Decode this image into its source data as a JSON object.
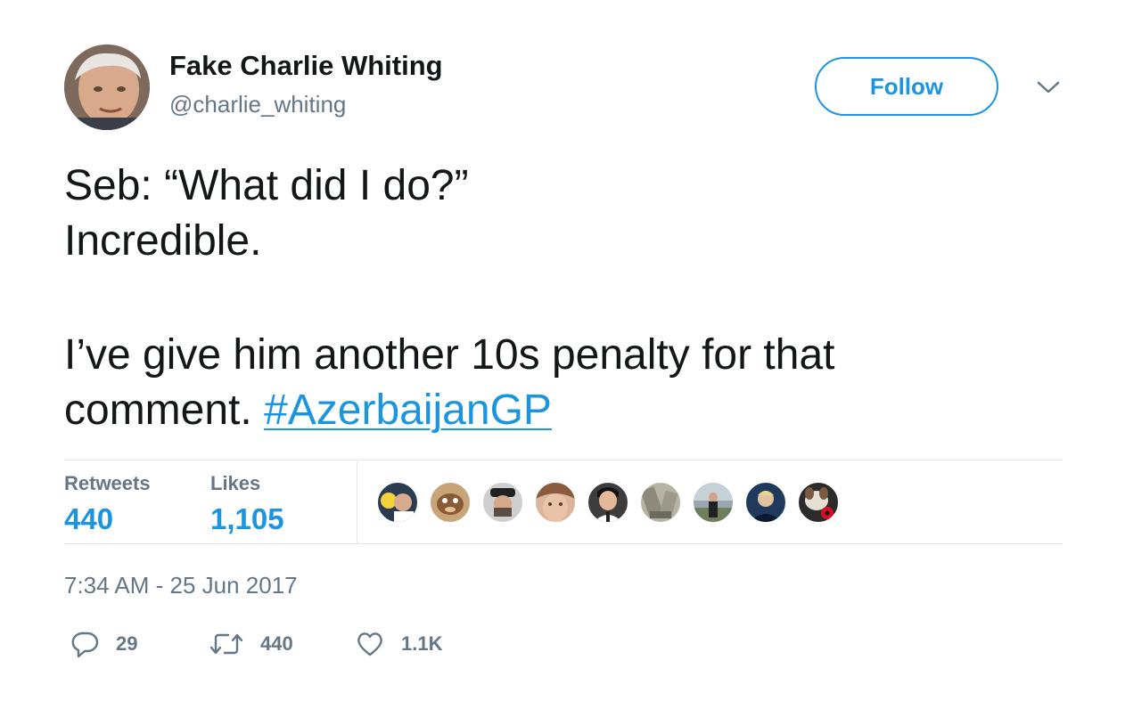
{
  "author": {
    "name": "Fake Charlie Whiting",
    "handle": "@charlie_whiting"
  },
  "follow_label": "Follow",
  "tweet": {
    "line1": "Seb: “What did I do?”",
    "line2": "Incredible.",
    "line3": "I’ve give him another 10s penalty for that",
    "line4": "comment. ",
    "hashtag": "#AzerbaijanGP"
  },
  "stats": {
    "retweets_label": "Retweets",
    "retweets_value": "440",
    "likes_label": "Likes",
    "likes_value": "1,105"
  },
  "likers": [
    "liker-avatar-1",
    "liker-avatar-2",
    "liker-avatar-3",
    "liker-avatar-4",
    "liker-avatar-5",
    "liker-avatar-6",
    "liker-avatar-7",
    "liker-avatar-8",
    "liker-avatar-9"
  ],
  "timestamp": "7:34 AM - 25 Jun 2017",
  "actions": {
    "reply_count": "29",
    "retweet_count": "440",
    "like_count": "1.1K"
  },
  "colors": {
    "accent": "#1b95e0",
    "text": "#14171a",
    "muted": "#657786",
    "divider": "#e1e8ed"
  },
  "icons": {
    "reply": "speech-bubble-icon",
    "retweet": "retweet-arrows-icon",
    "like": "heart-icon",
    "menu": "chevron-down-icon"
  }
}
